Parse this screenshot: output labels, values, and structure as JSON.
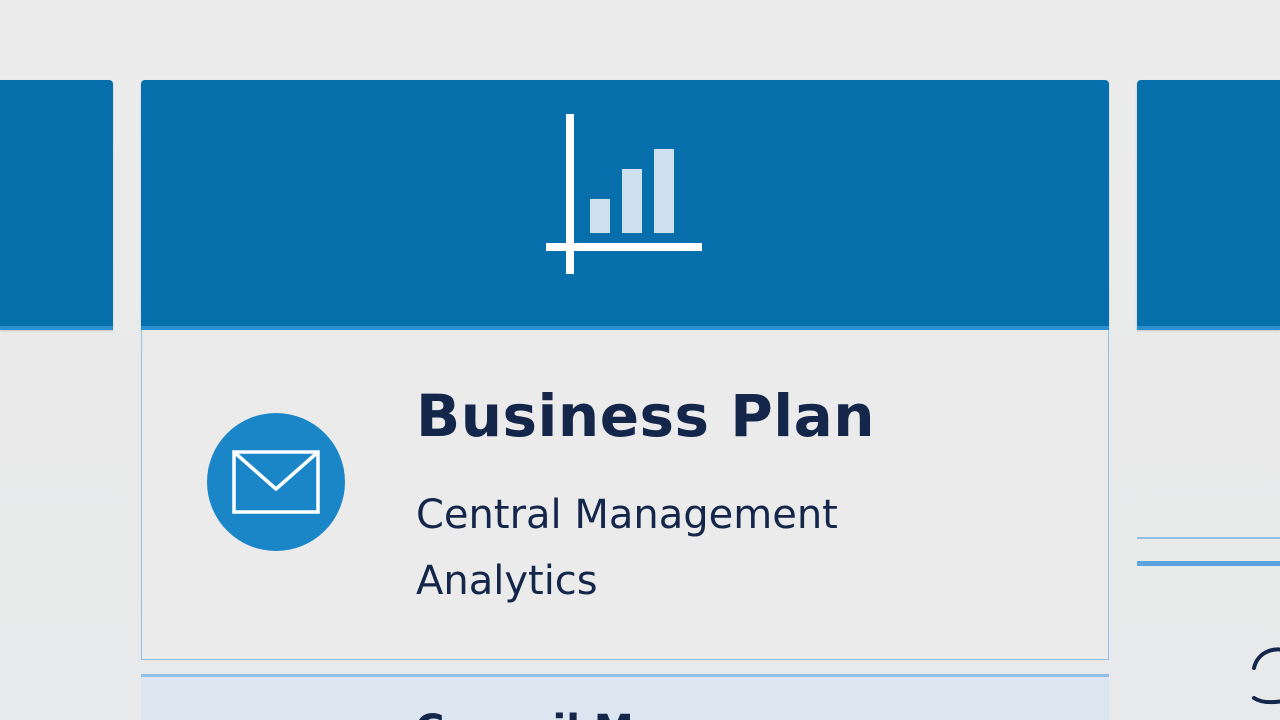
{
  "main_card": {
    "title": "Business Plan",
    "line1": "Central Management",
    "line2": "Analytics",
    "header_icon": "bar-chart-icon",
    "avatar_icon": "mail-icon"
  },
  "next_card": {
    "title_partial": "Council M"
  },
  "colors": {
    "header_blue": "#076fab",
    "header_accent": "#2c8fd0",
    "avatar_blue": "#1a86c8",
    "text_navy": "#14264a",
    "border_light_blue": "#8fc0e8",
    "background": "#e9eaeb"
  }
}
